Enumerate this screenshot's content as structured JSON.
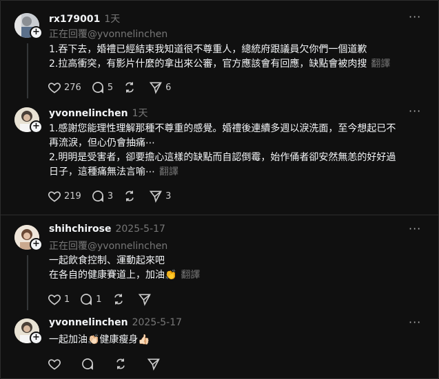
{
  "colors": {
    "background": "#101010",
    "text": "#f3f5f7",
    "secondary": "#777777",
    "divider": "#2d2d2d"
  },
  "posts": [
    {
      "username": "rx179001",
      "time": "1天",
      "reply_to": "正在回覆@yvonnelinchen",
      "lines": [
        "1.吞下去，婚禮已經結束我知道很不尊重人，總統府跟議員欠你們一個道歉",
        "2.拉高衝突，有影片什麼的拿出來公審，官方應該會有回應，缺點會被肉搜"
      ],
      "translate": "翻譯",
      "likes": "276",
      "comments": "5",
      "reposts": "",
      "shares": "6"
    },
    {
      "username": "yvonnelinchen",
      "time": "1天",
      "lines": [
        "1.感謝您能理性理解那種不尊重的感覺。婚禮後連續多週以淚洗面，至今想起已不",
        "再流淚，但心仍會抽痛⋯",
        "2.明明是受害者，卻要擔心這樣的缺點而自認倒霉，始作俑者卻安然無恙的好好過",
        "日子，這種痛無法言喻⋯"
      ],
      "translate": "翻譯",
      "likes": "219",
      "comments": "3",
      "reposts": "",
      "shares": "3"
    },
    {
      "username": "shihchirose",
      "time": "2025-5-17",
      "reply_to": "正在回覆@yvonnelinchen",
      "lines": [
        "一起飲食控制、運動起來吧",
        "在各自的健康賽道上，加油👏"
      ],
      "translate": "翻譯",
      "likes": "1",
      "comments": "1",
      "reposts": "",
      "shares": ""
    },
    {
      "username": "yvonnelinchen",
      "time": "2025-5-17",
      "lines": [
        "一起加油👏🏻健康瘦身👍🏻"
      ],
      "translate": "",
      "likes": "",
      "comments": "",
      "reposts": "",
      "shares": ""
    }
  ],
  "icons": {
    "like": "heart-icon",
    "comment": "comment-icon",
    "repost": "repost-icon",
    "share": "share-icon",
    "more": "more-icon",
    "follow": "plus-icon"
  }
}
